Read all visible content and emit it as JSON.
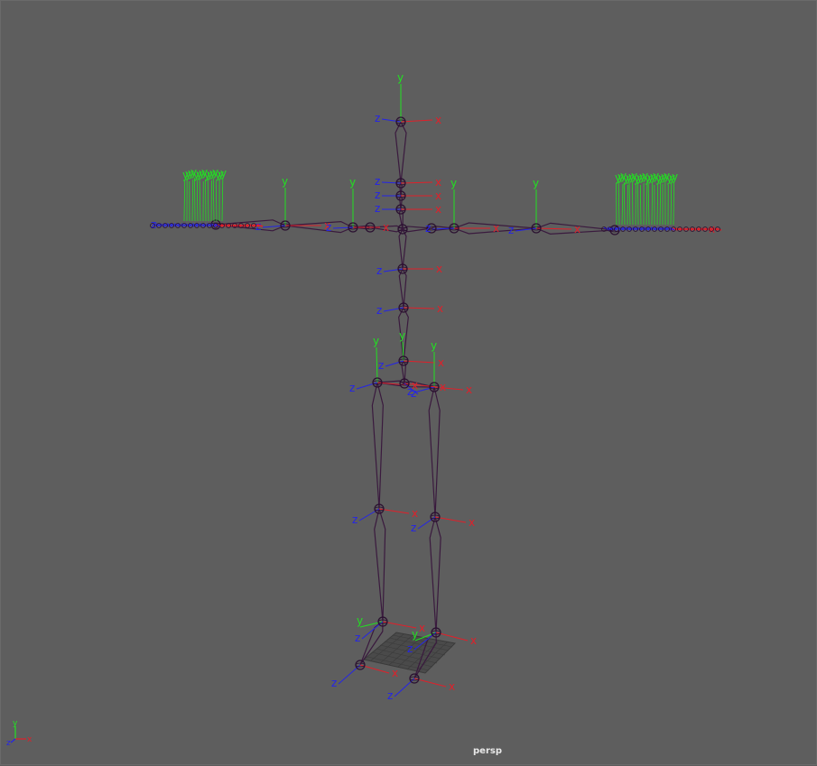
{
  "viewport": {
    "camera_name": "persp",
    "background_color": "#5e5e5e"
  },
  "colors": {
    "x_axis": "#e0202a",
    "y_axis": "#22e022",
    "z_axis": "#2424e8",
    "bone": "#3a1a3e",
    "joint": "#2a1030",
    "grid": "#4a4a4a"
  },
  "axis_labels": {
    "x": "x",
    "y": "y",
    "z": "z"
  },
  "gizmo": {
    "x": "x",
    "y": "y",
    "z": "z"
  }
}
